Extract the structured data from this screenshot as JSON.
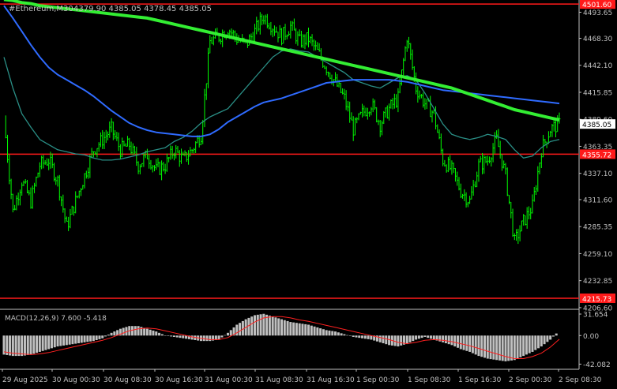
{
  "window": {
    "symbol_label": "#Ethereum,M30",
    "ohlc_text": "4379.90 4385.05 4378.45 4385.05"
  },
  "colors": {
    "background": "#000000",
    "axis": "#c0c0c0",
    "candle": "#00ff00",
    "ma_fast": "#2a8f86",
    "ma_mid": "#2f6bff",
    "ma_slow": "#33ee33",
    "level_line": "#ff1a1a",
    "macd_hist": "#c0c0c0",
    "macd_signal": "#ff2020",
    "tag_bg": "#ff1a1a",
    "price_tag_bg": "#ffffff"
  },
  "chart_data": [
    {
      "type": "candlestick",
      "x_ticks": [
        "29 Aug 2025",
        "30 Aug 00:30",
        "30 Aug 08:30",
        "30 Aug 16:30",
        "31 Aug 00:30",
        "31 Aug 08:30",
        "31 Aug 16:30",
        "1 Sep 00:30",
        "1 Sep 08:30",
        "1 Sep 16:30",
        "2 Sep 00:30",
        "2 Sep 08:30"
      ],
      "y_ticks": [
        4493.65,
        4468.3,
        4442.1,
        4415.85,
        4389.6,
        4363.35,
        4337.1,
        4311.6,
        4285.35,
        4259.1,
        4232.85,
        4206.6
      ],
      "ylim": [
        4205,
        4504
      ],
      "current_price": 4385.05,
      "horizontal_levels": [
        {
          "label": "4501.60",
          "value": 4501.6
        },
        {
          "label": "4355.72",
          "value": 4355.72
        },
        {
          "label": "4215.73",
          "value": 4215.73
        }
      ],
      "series": [
        {
          "name": "close",
          "values": [
            4390,
            4300,
            4330,
            4310,
            4345,
            4350,
            4330,
            4285,
            4310,
            4335,
            4360,
            4370,
            4380,
            4360,
            4365,
            4345,
            4355,
            4340,
            4345,
            4360,
            4350,
            4360,
            4375,
            4465,
            4470,
            4478,
            4468,
            4462,
            4475,
            4490,
            4480,
            4470,
            4480,
            4465,
            4468,
            4455,
            4440,
            4425,
            4410,
            4380,
            4395,
            4405,
            4385,
            4400,
            4410,
            4470,
            4420,
            4405,
            4395,
            4350,
            4340,
            4320,
            4310,
            4345,
            4350,
            4370,
            4335,
            4270,
            4290,
            4305,
            4360,
            4380,
            4385.05
          ]
        },
        {
          "name": "ma_fast",
          "values": [
            4450,
            4420,
            4395,
            4382,
            4370,
            4365,
            4360,
            4358,
            4356,
            4355,
            4352,
            4350,
            4350,
            4351,
            4353,
            4355,
            4358,
            4360,
            4362,
            4368,
            4372,
            4378,
            4386,
            4392,
            4396,
            4400,
            4410,
            4420,
            4430,
            4440,
            4450,
            4456,
            4458,
            4456,
            4455,
            4450,
            4445,
            4440,
            4435,
            4428,
            4425,
            4422,
            4420,
            4425,
            4430,
            4432,
            4428,
            4415,
            4400,
            4385,
            4375,
            4372,
            4370,
            4372,
            4375,
            4373,
            4370,
            4360,
            4352,
            4354,
            4362,
            4368,
            4370
          ]
        },
        {
          "name": "ma_mid",
          "values": [
            4500,
            4488,
            4475,
            4462,
            4450,
            4440,
            4433,
            4428,
            4423,
            4418,
            4412,
            4405,
            4398,
            4392,
            4386,
            4382,
            4379,
            4377,
            4376,
            4375,
            4374,
            4373,
            4373,
            4375,
            4380,
            4387,
            4392,
            4397,
            4402,
            4406,
            4408,
            4410,
            4413,
            4416,
            4419,
            4422,
            4425,
            4426,
            4427,
            4428,
            4428,
            4428,
            4428,
            4428,
            4427,
            4426,
            4424,
            4422,
            4420,
            4418,
            4417,
            4416,
            4415,
            4414,
            4413,
            4412,
            4411,
            4410,
            4409,
            4408,
            4407,
            4406,
            4405
          ]
        },
        {
          "name": "ma_slow",
          "values": [
            4506,
            4505,
            4503,
            4502,
            4500,
            4499,
            4498,
            4497,
            4496,
            4495,
            4494,
            4493,
            4492,
            4491,
            4490,
            4489,
            4488,
            4486,
            4484,
            4482,
            4480,
            4478,
            4476,
            4474,
            4472,
            4470,
            4468,
            4466,
            4464,
            4462,
            4460,
            4458,
            4456,
            4454,
            4452,
            4450,
            4448,
            4446,
            4444,
            4442,
            4440,
            4438,
            4436,
            4434,
            4432,
            4430,
            4428,
            4426,
            4424,
            4422,
            4420,
            4417,
            4414,
            4411,
            4408,
            4405,
            4402,
            4399,
            4397,
            4395,
            4393,
            4391,
            4389
          ]
        }
      ]
    },
    {
      "type": "bar",
      "title": "MACD(12,26,9) 7.600 -5.418",
      "y_ticks": [
        31.654,
        0.0,
        -42.082
      ],
      "ylim": [
        -45,
        34
      ],
      "series": [
        {
          "name": "macd",
          "values": [
            -28,
            -30,
            -30,
            -28,
            -24,
            -20,
            -16,
            -14,
            -12,
            -10,
            -8,
            -4,
            4,
            10,
            14,
            14,
            10,
            6,
            0,
            -2,
            -4,
            -6,
            -8,
            -8,
            -6,
            4,
            16,
            24,
            30,
            32,
            28,
            24,
            20,
            18,
            16,
            12,
            8,
            6,
            2,
            -2,
            -4,
            -6,
            -10,
            -14,
            -16,
            -12,
            -6,
            -2,
            -6,
            -10,
            -14,
            -20,
            -24,
            -30,
            -34,
            -36,
            -38,
            -36,
            -30,
            -24,
            -16,
            -6,
            7.6
          ]
        },
        {
          "name": "signal",
          "values": [
            -24,
            -26,
            -27,
            -28,
            -27,
            -25,
            -22,
            -19,
            -16,
            -13,
            -10,
            -7,
            -3,
            2,
            7,
            10,
            11,
            10,
            7,
            4,
            1,
            -2,
            -4,
            -6,
            -6,
            -3,
            4,
            12,
            20,
            26,
            28,
            28,
            26,
            23,
            21,
            18,
            15,
            12,
            9,
            6,
            3,
            0,
            -3,
            -6,
            -10,
            -12,
            -10,
            -7,
            -6,
            -7,
            -9,
            -12,
            -15,
            -19,
            -23,
            -27,
            -31,
            -34,
            -34,
            -31,
            -26,
            -17,
            -5.418
          ]
        }
      ]
    }
  ]
}
